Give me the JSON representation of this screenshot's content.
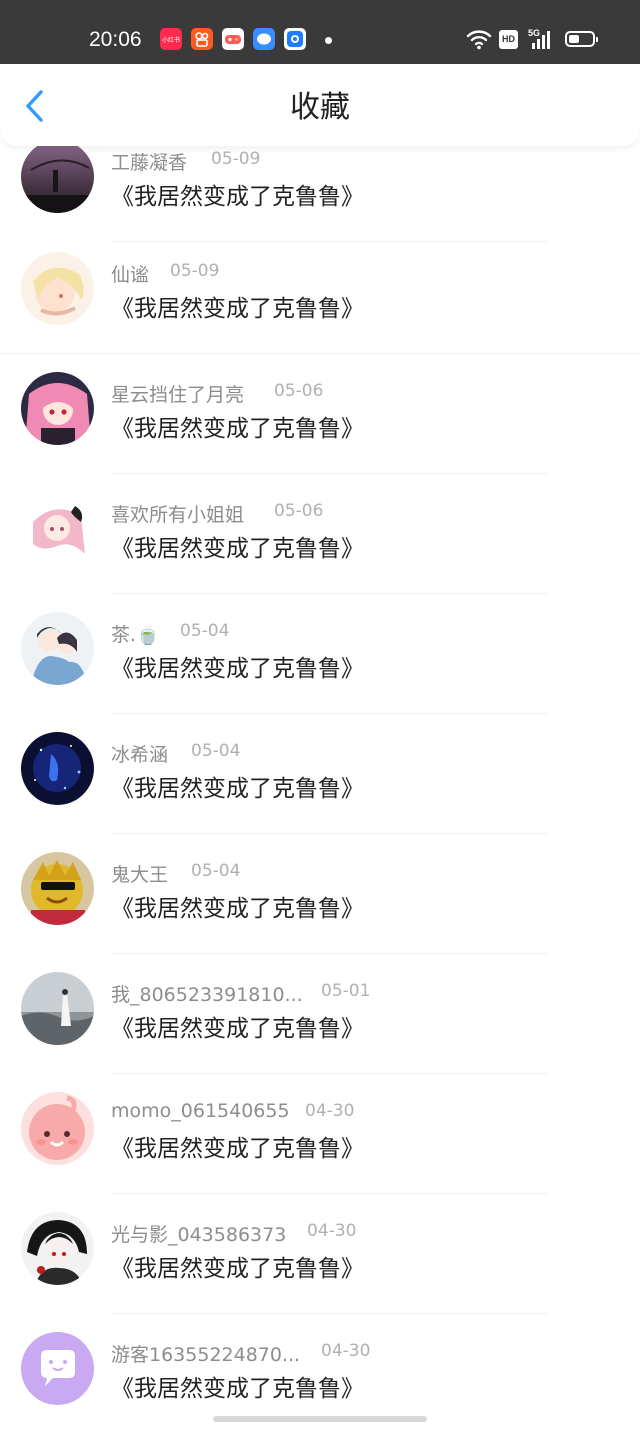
{
  "status": {
    "time": "20:06",
    "app_icons": [
      "xiaohongshu-icon",
      "kuaishou-icon",
      "game-icon",
      "chat-icon",
      "browser-icon"
    ],
    "hd": "HD",
    "network": "5G"
  },
  "header": {
    "title": "收藏"
  },
  "items": [
    {
      "user": "工藤凝香",
      "date": "05-09",
      "title": "《我居然变成了克鲁鲁》"
    },
    {
      "user": "仙谧",
      "date": "05-09",
      "title": "《我居然变成了克鲁鲁》"
    },
    {
      "user": "星云挡住了月亮",
      "date": "05-06",
      "title": "《我居然变成了克鲁鲁》"
    },
    {
      "user": "喜欢所有小姐姐",
      "date": "05-06",
      "title": "《我居然变成了克鲁鲁》"
    },
    {
      "user": "茶.🍵",
      "date": "05-04",
      "title": "《我居然变成了克鲁鲁》"
    },
    {
      "user": "冰希涵",
      "date": "05-04",
      "title": "《我居然变成了克鲁鲁》"
    },
    {
      "user": "鬼大王",
      "date": "05-04",
      "title": "《我居然变成了克鲁鲁》"
    },
    {
      "user": "我_806523391810...",
      "date": "05-01",
      "title": "《我居然变成了克鲁鲁》"
    },
    {
      "user": "momo_061540655",
      "date": "04-30",
      "title": "《我居然变成了克鲁鲁》"
    },
    {
      "user": "光与影_043586373",
      "date": "04-30",
      "title": "《我居然变成了克鲁鲁》"
    },
    {
      "user": "游客16355224870...",
      "date": "04-30",
      "title": "《我居然变成了克鲁鲁》"
    }
  ],
  "colors": {
    "accent": "#2e9bff",
    "status_bar": "#3a3a3a"
  }
}
